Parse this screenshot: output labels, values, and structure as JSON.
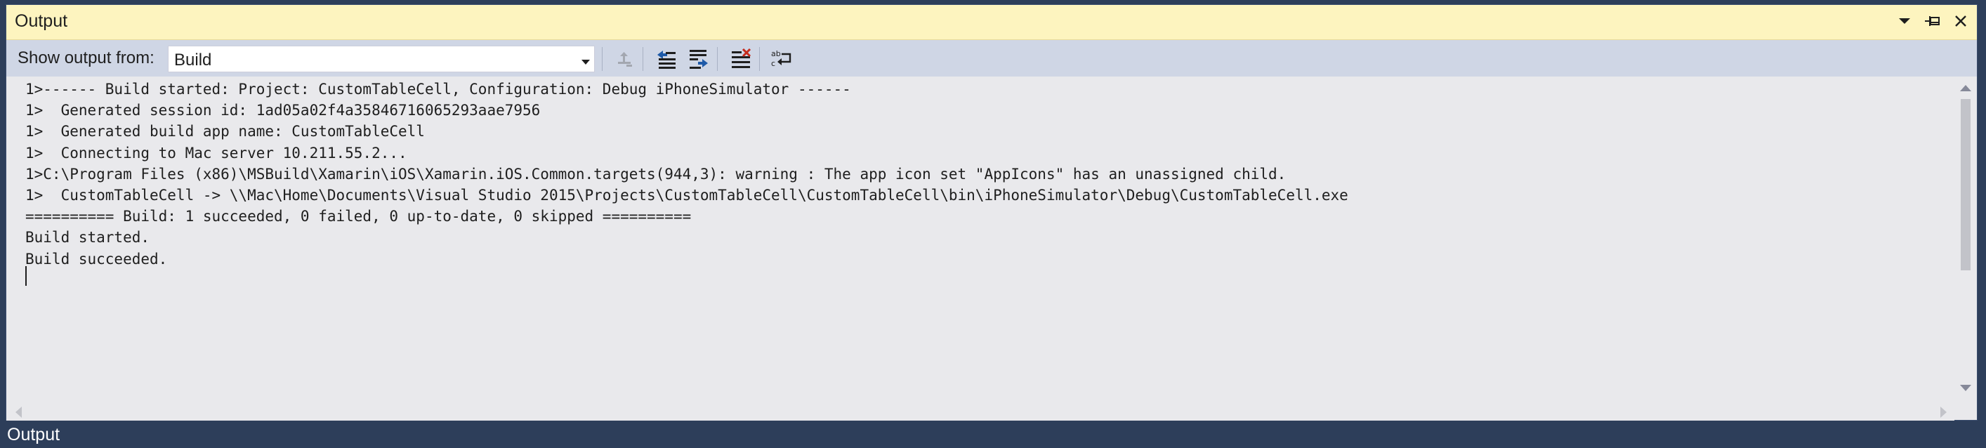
{
  "panel": {
    "title": "Output"
  },
  "toolbar": {
    "show_output_label": "Show output from:",
    "source_selected": "Build"
  },
  "output": {
    "lines": [
      "1>------ Build started: Project: CustomTableCell, Configuration: Debug iPhoneSimulator ------",
      "1>  Generated session id: 1ad05a02f4a35846716065293aae7956",
      "1>  Generated build app name: CustomTableCell",
      "1>  Connecting to Mac server 10.211.55.2...",
      "1>C:\\Program Files (x86)\\MSBuild\\Xamarin\\iOS\\Xamarin.iOS.Common.targets(944,3): warning : The app icon set \"AppIcons\" has an unassigned child.",
      "1>  CustomTableCell -> \\\\Mac\\Home\\Documents\\Visual Studio 2015\\Projects\\CustomTableCell\\CustomTableCell\\bin\\iPhoneSimulator\\Debug\\CustomTableCell.exe",
      "========== Build: 1 succeeded, 0 failed, 0 up-to-date, 0 skipped ==========",
      "Build started.",
      "Build succeeded."
    ]
  },
  "statusbar": {
    "label": "Output"
  },
  "icons": {
    "window_position": "chevron-down-icon",
    "auto_hide": "pin-icon",
    "close": "close-icon",
    "find_code": "find-message-in-code-icon",
    "prev_message": "go-to-previous-message-icon",
    "next_message": "go-to-next-message-icon",
    "clear_all": "clear-all-icon",
    "word_wrap": "toggle-word-wrap-icon"
  },
  "colors": {
    "title_background": "#fdf4bf",
    "toolbar_background": "#cfd6e5",
    "output_background": "#e9e9ec",
    "frame": "#2d3e5a",
    "accent_blue": "#1e5aa8",
    "accent_red": "#c42b1c"
  }
}
